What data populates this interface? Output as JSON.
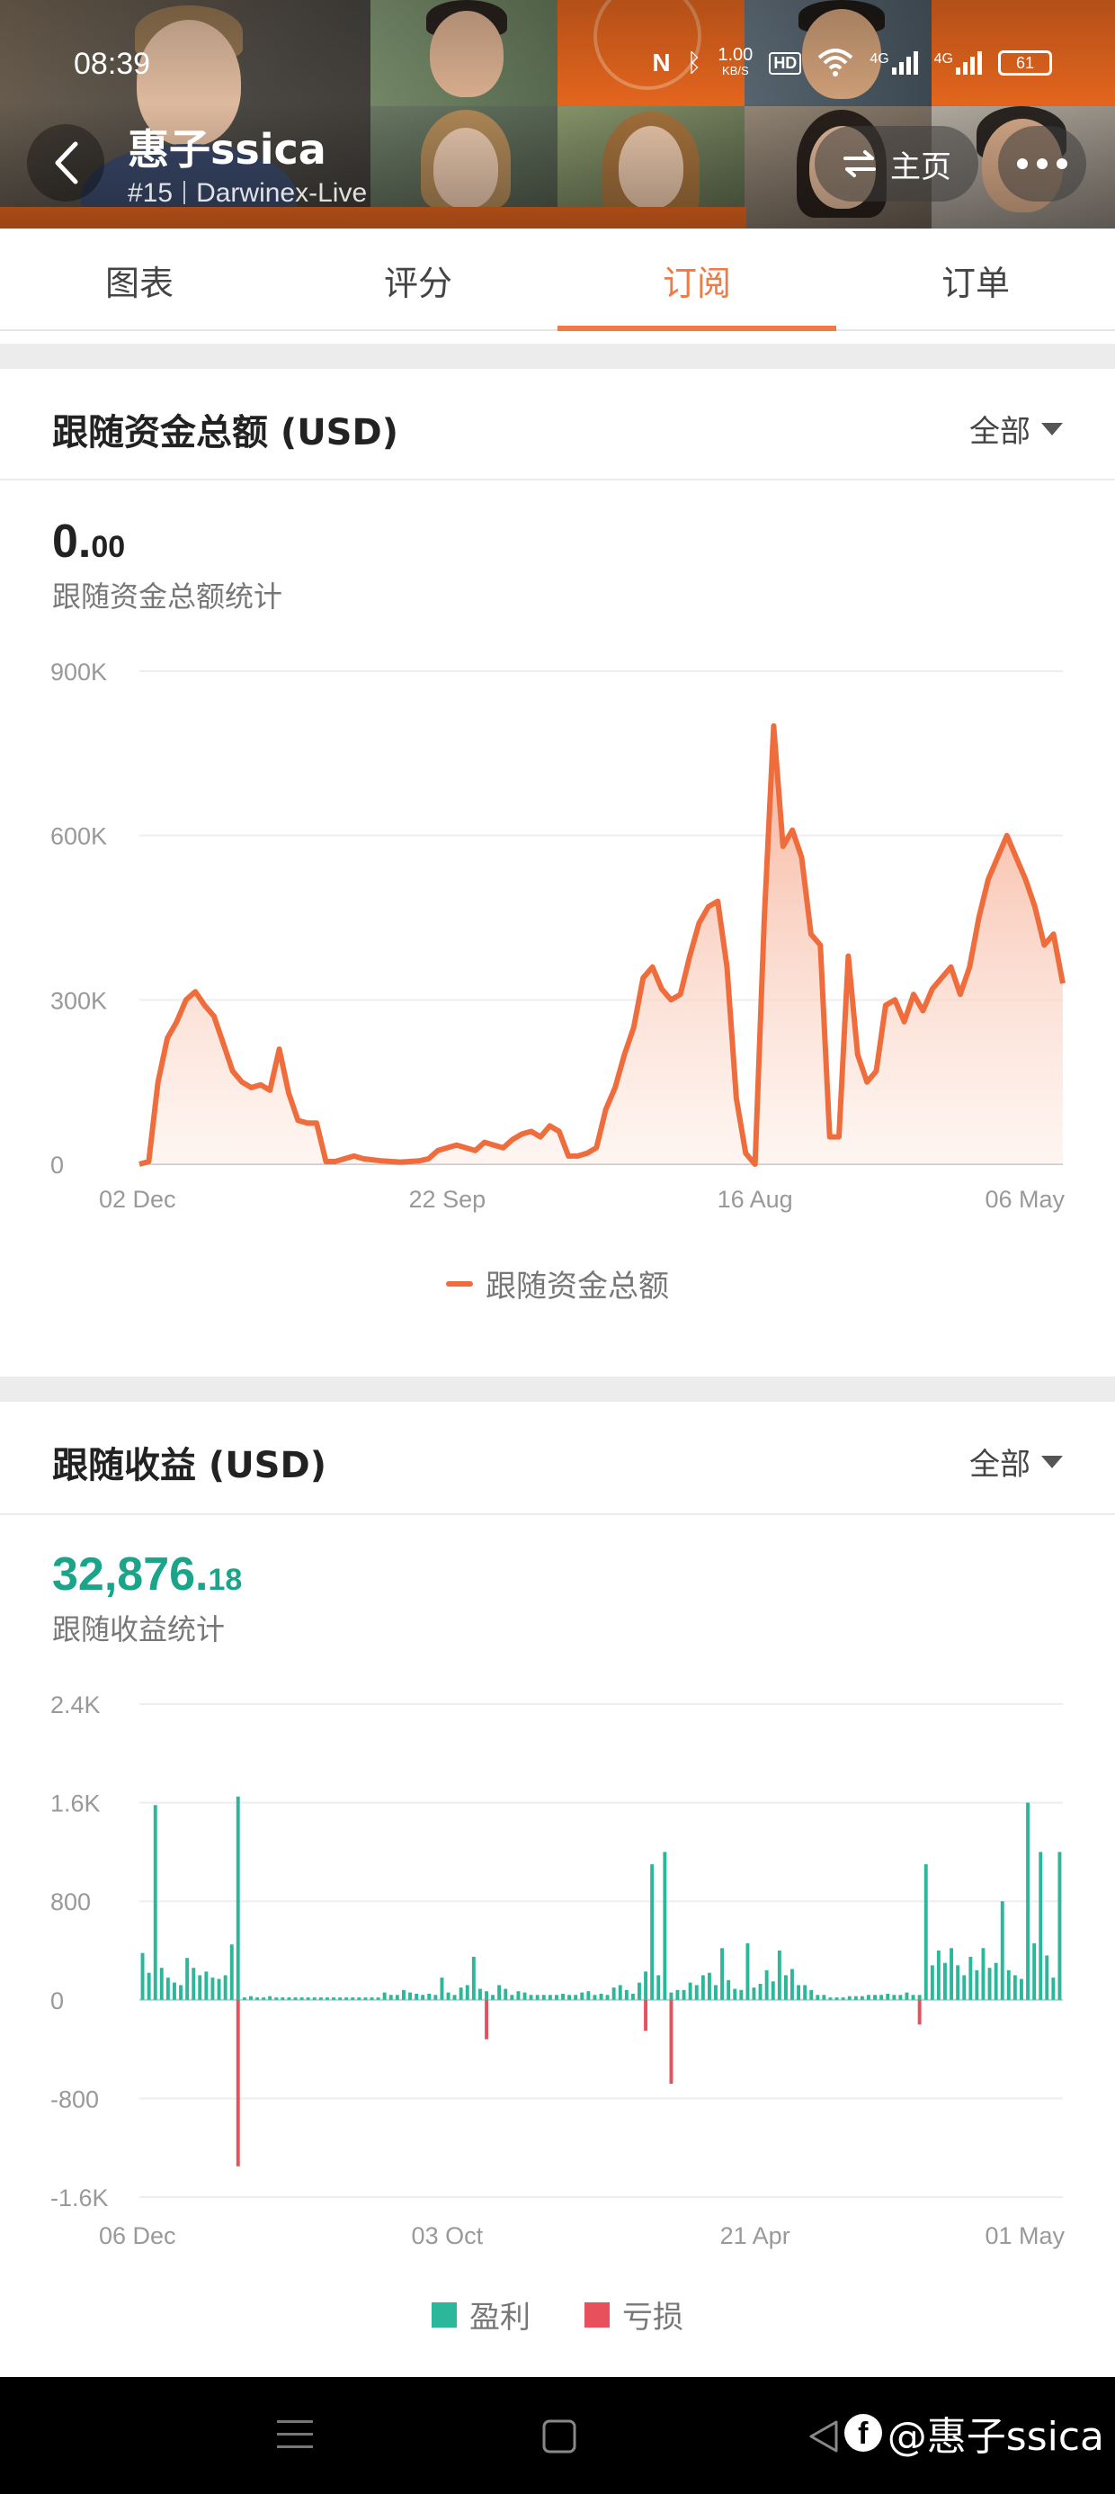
{
  "status_bar": {
    "time": "08:39",
    "net_speed_value": "1.00",
    "net_speed_unit": "KB/S",
    "hd_label": "HD",
    "signal1_label": "4G",
    "signal2_label": "4G",
    "battery": "61"
  },
  "profile": {
    "name": "惠子ssica",
    "rank": "#15",
    "broker": "Darwinex-Live"
  },
  "header_buttons": {
    "home_label": "主页"
  },
  "tabs": [
    {
      "label": "图表",
      "active": false
    },
    {
      "label": "评分",
      "active": false
    },
    {
      "label": "订阅",
      "active": true
    },
    {
      "label": "订单",
      "active": false
    }
  ],
  "panel1": {
    "title": "跟随资金总额 (USD)",
    "filter": "全部",
    "value_int": "0.",
    "value_dec": "00",
    "subtitle": "跟随资金总额统计",
    "legend": "跟随资金总额"
  },
  "panel2": {
    "title": "跟随收益 (USD)",
    "filter": "全部",
    "value_int": "32,876.",
    "value_dec": "18",
    "subtitle": "跟随收益统计",
    "legend_profit": "盈利",
    "legend_loss": "亏损"
  },
  "watermark": "@惠子ssica",
  "colors": {
    "accent": "#ef7a45",
    "line": "#ef6c3c",
    "profit": "#2bb79a",
    "loss": "#e8505b",
    "value_green": "#1aa58a"
  },
  "chart_data": [
    {
      "type": "area",
      "y_ticks": [
        "900K",
        "600K",
        "300K",
        "0"
      ],
      "ylim": [
        0,
        900000
      ],
      "x_ticks": [
        "02 Dec",
        "22 Sep",
        "16 Aug",
        "06 May"
      ],
      "legend_position": "bottom-center",
      "series": [
        {
          "name": "跟随资金总额",
          "values": [
            0,
            5000,
            150000,
            230000,
            260000,
            300000,
            315000,
            290000,
            270000,
            220000,
            170000,
            150000,
            140000,
            145000,
            135000,
            210000,
            130000,
            80000,
            75000,
            75000,
            5000,
            5000,
            10000,
            15000,
            10000,
            8000,
            6000,
            5000,
            4000,
            5000,
            6000,
            10000,
            25000,
            30000,
            35000,
            30000,
            25000,
            40000,
            35000,
            30000,
            45000,
            55000,
            60000,
            50000,
            70000,
            60000,
            15000,
            15000,
            20000,
            30000,
            100000,
            140000,
            200000,
            250000,
            340000,
            360000,
            320000,
            300000,
            310000,
            380000,
            440000,
            470000,
            480000,
            360000,
            120000,
            20000,
            0,
            450000,
            800000,
            580000,
            610000,
            560000,
            420000,
            400000,
            50000,
            50000,
            380000,
            200000,
            150000,
            170000,
            290000,
            300000,
            260000,
            310000,
            280000,
            320000,
            340000,
            360000,
            310000,
            360000,
            450000,
            520000,
            560000,
            600000,
            560000,
            520000,
            470000,
            400000,
            420000,
            330000
          ]
        }
      ]
    },
    {
      "type": "bar",
      "y_ticks": [
        "2.4K",
        "1.6K",
        "800",
        "0",
        "-800",
        "-1.6K"
      ],
      "ylim": [
        -1600,
        2400
      ],
      "x_ticks": [
        "06 Dec",
        "03 Oct",
        "21 Apr",
        "01 May"
      ],
      "legend_position": "bottom-center",
      "series": [
        {
          "name": "盈利",
          "values": [
            380,
            220,
            1580,
            260,
            180,
            140,
            120,
            340,
            260,
            200,
            230,
            180,
            170,
            200,
            450,
            1650,
            20,
            30,
            20,
            20,
            30,
            20,
            20,
            20,
            20,
            20,
            20,
            20,
            20,
            20,
            20,
            20,
            20,
            20,
            20,
            20,
            20,
            20,
            60,
            40,
            40,
            80,
            60,
            50,
            40,
            50,
            40,
            180,
            60,
            40,
            100,
            120,
            350,
            90,
            70,
            40,
            120,
            90,
            40,
            70,
            60,
            40,
            40,
            40,
            40,
            40,
            50,
            40,
            40,
            60,
            70,
            40,
            50,
            40,
            100,
            120,
            80,
            50,
            140,
            230,
            1100,
            200,
            1200,
            60,
            80,
            80,
            140,
            120,
            200,
            220,
            120,
            420,
            160,
            90,
            80,
            460,
            100,
            130,
            240,
            150,
            400,
            200,
            250,
            120,
            120,
            80,
            40,
            40,
            20,
            20,
            20,
            30,
            30,
            30,
            40,
            40,
            40,
            50,
            40,
            40,
            60,
            40,
            40,
            1100,
            280,
            400,
            300,
            420,
            280,
            200,
            350,
            240,
            420,
            260,
            300,
            800,
            240,
            200,
            170,
            1600,
            460,
            1200,
            360,
            180,
            1200
          ]
        },
        {
          "name": "亏损",
          "values": [
            0,
            0,
            0,
            0,
            0,
            0,
            0,
            0,
            0,
            0,
            0,
            0,
            0,
            0,
            0,
            -1350,
            0,
            0,
            0,
            0,
            0,
            0,
            0,
            0,
            0,
            0,
            0,
            0,
            0,
            0,
            0,
            0,
            0,
            0,
            0,
            0,
            0,
            0,
            0,
            0,
            0,
            0,
            0,
            0,
            0,
            0,
            0,
            0,
            0,
            0,
            0,
            0,
            0,
            0,
            -320,
            0,
            0,
            0,
            0,
            0,
            0,
            0,
            0,
            0,
            0,
            0,
            0,
            0,
            0,
            0,
            0,
            0,
            0,
            0,
            0,
            0,
            0,
            0,
            0,
            -250,
            0,
            0,
            0,
            -680,
            0,
            0,
            0,
            0,
            0,
            0,
            0,
            0,
            0,
            0,
            0,
            0,
            0,
            0,
            0,
            0,
            0,
            0,
            0,
            0,
            0,
            0,
            0,
            0,
            0,
            0,
            0,
            0,
            0,
            0,
            0,
            0,
            0,
            0,
            0,
            0,
            0,
            0,
            -200,
            0,
            0,
            0,
            0,
            0,
            0,
            0,
            0,
            0,
            0,
            0,
            0,
            0,
            0,
            0,
            0,
            0,
            0,
            0,
            0,
            0,
            0
          ]
        }
      ]
    }
  ]
}
